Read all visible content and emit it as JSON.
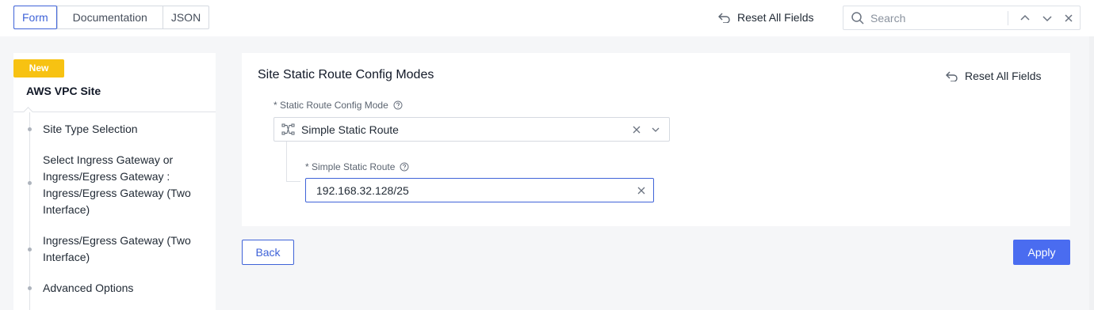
{
  "tabs": [
    {
      "label": "Form",
      "active": true
    },
    {
      "label": "Documentation",
      "active": false
    },
    {
      "label": "JSON",
      "active": false
    }
  ],
  "toolbar": {
    "reset_label": "Reset All Fields",
    "search_placeholder": "Search"
  },
  "sidebar": {
    "badge": "New",
    "title": "AWS VPC Site",
    "items": [
      {
        "label": "Site Type Selection"
      },
      {
        "label": "Select Ingress Gateway or Ingress/Egress Gateway : Ingress/Egress Gateway (Two Interface)"
      },
      {
        "label": "Ingress/Egress Gateway (Two Interface)"
      },
      {
        "label": "Advanced Options"
      }
    ]
  },
  "section": {
    "title": "Site Static Route Config Modes",
    "reset_label": "Reset All Fields",
    "mode_field": {
      "label": "* Static Route Config Mode",
      "value": "Simple Static Route"
    },
    "route_field": {
      "label": "* Simple Static Route",
      "value": "192.168.32.128/25"
    }
  },
  "actions": {
    "back_label": "Back",
    "apply_label": "Apply"
  },
  "colors": {
    "accent": "#3f63d8",
    "primary_button": "#4a6cf0",
    "badge": "#f7c212"
  }
}
